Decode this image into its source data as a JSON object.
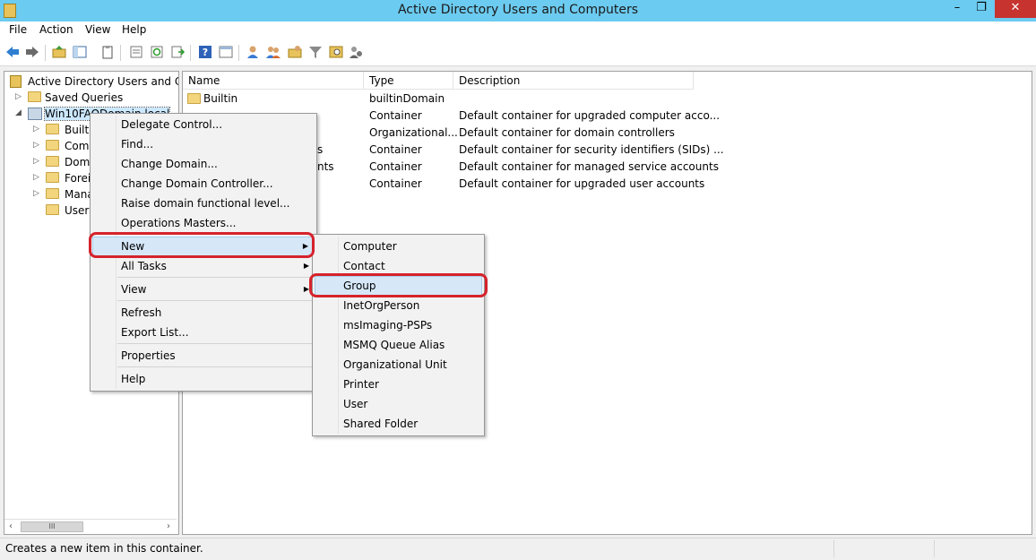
{
  "window": {
    "title": "Active Directory Users and Computers",
    "min_label": "–",
    "max_label": "❐",
    "close_label": "✕"
  },
  "menubar": [
    "File",
    "Action",
    "View",
    "Help"
  ],
  "toolbar": [
    "back-icon",
    "forward-icon",
    "up-folder-icon",
    "console-tree-icon",
    "clipboard-icon",
    "properties-icon",
    "refresh-icon",
    "export-icon",
    "help-icon",
    "console-icon",
    "new-user-icon",
    "new-group-icon",
    "new-ou-icon",
    "filter-icon",
    "find-icon",
    "delegate-icon"
  ],
  "tree": {
    "root": "Active Directory Users and Com",
    "saved_queries": "Saved Queries",
    "domain": "Win10FAQDomain.local",
    "children": [
      "Builtin",
      "Comp",
      "Doma",
      "Foreig",
      "Manag",
      "Users"
    ]
  },
  "scrollbar": {
    "left": "‹",
    "thumb": "III",
    "right": "›"
  },
  "list": {
    "columns": [
      "Name",
      "Type",
      "Description"
    ],
    "rows": [
      {
        "name": "Builtin",
        "type": "builtinDomain",
        "desc": ""
      },
      {
        "name": "",
        "type": "Container",
        "desc": "Default container for upgraded computer acco..."
      },
      {
        "name": "",
        "type": "Organizational...",
        "desc": "Default container for domain controllers"
      },
      {
        "name": "s",
        "type": "Container",
        "desc": "Default container for security identifiers (SIDs) ..."
      },
      {
        "name": "nts",
        "type": "Container",
        "desc": "Default container for managed service accounts"
      },
      {
        "name": "",
        "type": "Container",
        "desc": "Default container for upgraded user accounts"
      }
    ]
  },
  "context_menu": {
    "items": [
      "Delegate Control...",
      "Find...",
      "Change Domain...",
      "Change Domain Controller...",
      "Raise domain functional level...",
      "Operations Masters...",
      "New",
      "All Tasks",
      "View",
      "Refresh",
      "Export List...",
      "Properties",
      "Help"
    ],
    "submenu_arrow": "▶",
    "highlighted": "New"
  },
  "new_submenu": {
    "items": [
      "Computer",
      "Contact",
      "Group",
      "InetOrgPerson",
      "msImaging-PSPs",
      "MSMQ Queue Alias",
      "Organizational Unit",
      "Printer",
      "User",
      "Shared Folder"
    ],
    "highlighted": "Group"
  },
  "status": {
    "message": "Creates a new item in this container."
  },
  "colors": {
    "titlebar": "#6ccbf0",
    "close": "#c7332e",
    "highlight_box": "#d6232c",
    "menu_highlight": "#d6e8f8"
  }
}
